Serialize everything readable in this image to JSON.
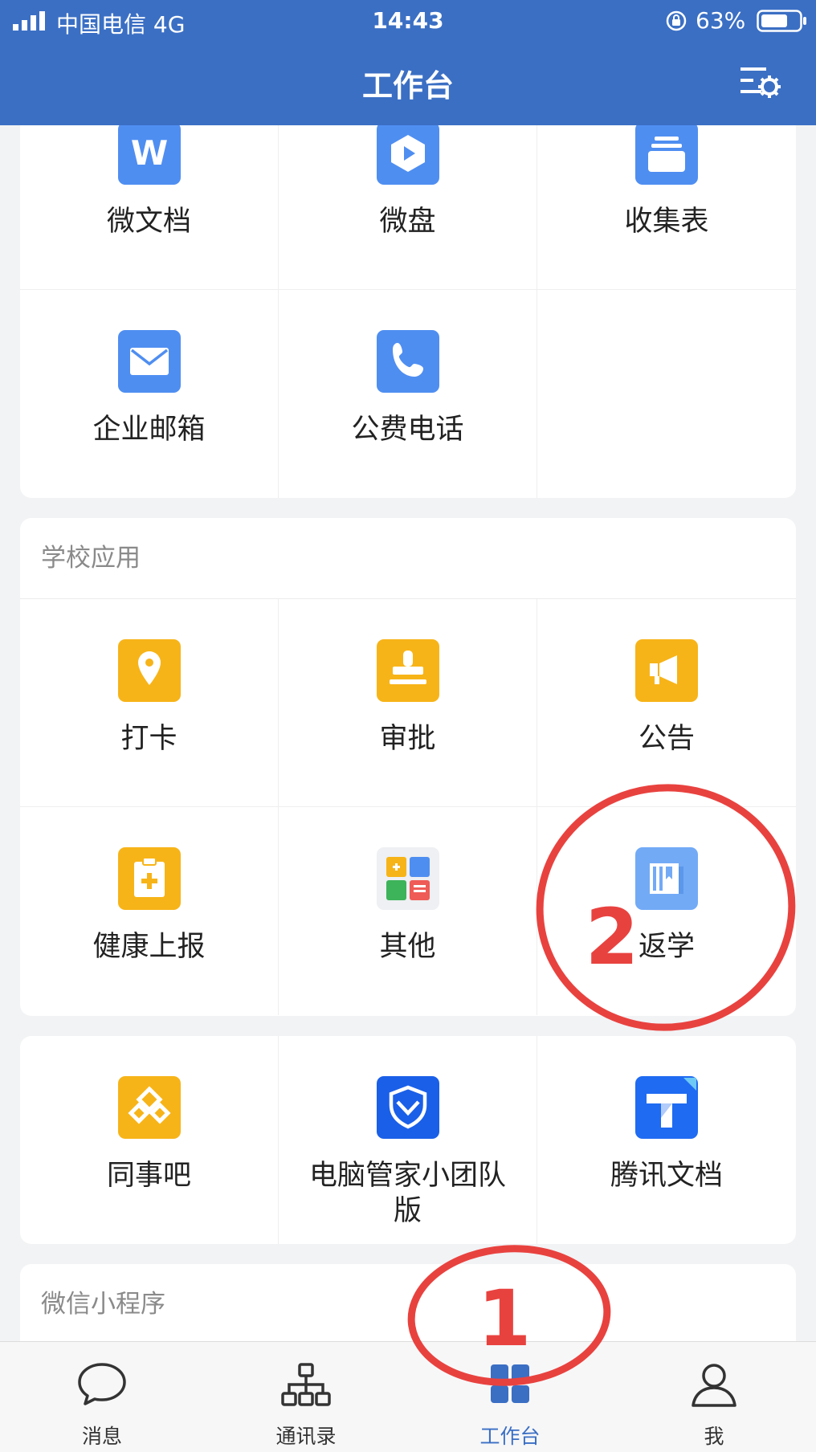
{
  "status_bar": {
    "carrier": "中国电信   4G",
    "time": "14:43",
    "battery": "63%"
  },
  "header": {
    "title": "工作台"
  },
  "sections": {
    "top": {
      "apps": [
        {
          "label": "微文档",
          "icon": "w-doc-icon",
          "icon_text": "W"
        },
        {
          "label": "微盘",
          "icon": "cloud-drive-icon"
        },
        {
          "label": "收集表",
          "icon": "collection-form-icon"
        },
        {
          "label": "企业邮箱",
          "icon": "mail-icon"
        },
        {
          "label": "公费电话",
          "icon": "phone-icon"
        }
      ]
    },
    "school": {
      "title": "学校应用",
      "apps": [
        {
          "label": "打卡",
          "icon": "location-pin-icon"
        },
        {
          "label": "审批",
          "icon": "stamp-icon"
        },
        {
          "label": "公告",
          "icon": "megaphone-icon"
        },
        {
          "label": "健康上报",
          "icon": "clipboard-plus-icon"
        },
        {
          "label": "其他",
          "icon": "apps-grid-icon"
        },
        {
          "label": "返学",
          "icon": "book-icon"
        }
      ]
    },
    "third_party": {
      "apps": [
        {
          "label": "同事吧",
          "icon": "colleague-bar-icon"
        },
        {
          "label": "电脑管家小团队版",
          "icon": "pc-manager-shield-icon"
        },
        {
          "label": "腾讯文档",
          "icon": "tencent-docs-icon"
        }
      ]
    },
    "mini_programs": {
      "title": "微信小程序"
    }
  },
  "tabbar": {
    "tabs": [
      {
        "label": "消息",
        "icon": "chat-bubble-icon"
      },
      {
        "label": "通讯录",
        "icon": "org-chart-icon"
      },
      {
        "label": "工作台",
        "icon": "workbench-grid-icon",
        "active": true
      },
      {
        "label": "我",
        "icon": "person-icon"
      }
    ]
  },
  "annotations": {
    "mark_1": "1",
    "mark_2": "2"
  },
  "colors": {
    "header_bg": "#3b6fc4",
    "icon_blue": "#4f8ef1",
    "icon_yellow": "#f7b418",
    "annotation_red": "#e8423f"
  }
}
